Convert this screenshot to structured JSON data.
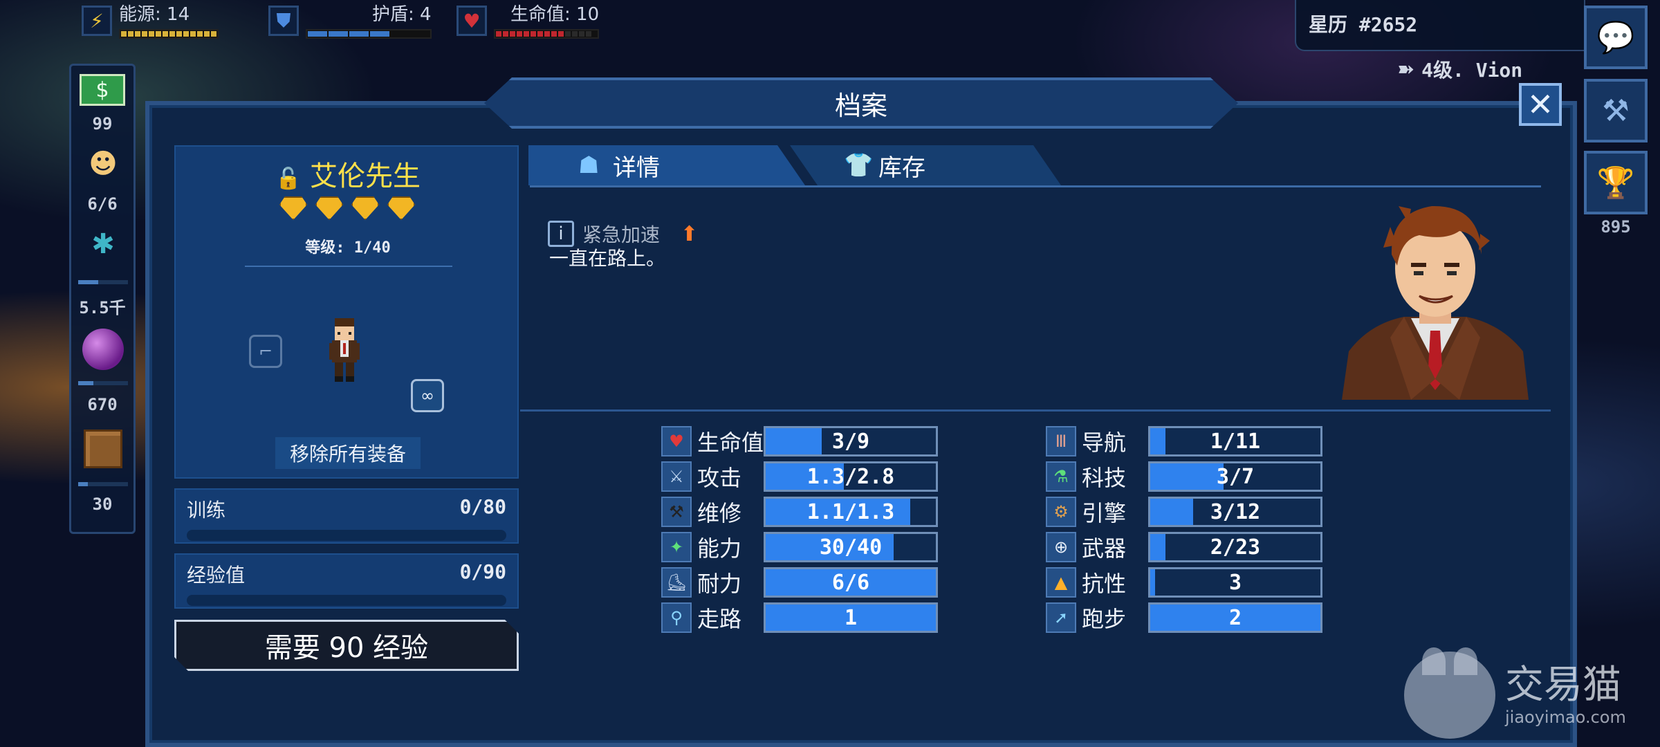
{
  "hud": {
    "energy": {
      "label": "能源: 14",
      "color": "#d8b23a"
    },
    "shield": {
      "label": "护盾: 4",
      "color": "#3a78c8"
    },
    "health": {
      "label": "生命值: 10",
      "color": "#c0262e"
    }
  },
  "calendar": "星历 #2652",
  "rank": "4级. Vion",
  "side_buttons": {
    "trophy_count": "895"
  },
  "resources": [
    {
      "icon": "money-icon",
      "value": "99"
    },
    {
      "icon": "crew-icon",
      "value": "6/6"
    },
    {
      "icon": "crystal-icon",
      "value": "5.5千"
    },
    {
      "icon": "orb-icon",
      "value": "670"
    },
    {
      "icon": "crate-icon",
      "value": "30"
    }
  ],
  "panel": {
    "title": "档案"
  },
  "character": {
    "name": "艾伦先生",
    "level": "等级: 1/40",
    "remove_label": "移除所有装备",
    "rarity_stars": 4
  },
  "training": {
    "label": "训练",
    "value": "0/80"
  },
  "experience": {
    "label": "经验值",
    "value": "0/90"
  },
  "need_button": "需要 90 经验",
  "tabs": {
    "details": "详情",
    "inventory": "库存"
  },
  "skill": {
    "name": "紧急加速",
    "description": "一直在路上。"
  },
  "stats_left": [
    {
      "icon": "heart-icon",
      "label": "生命值",
      "value": "3/9",
      "fill": 0.33
    },
    {
      "icon": "sword-icon",
      "label": "攻击",
      "value": "1.3/2.8",
      "fill": 0.46
    },
    {
      "icon": "hammer-icon",
      "label": "维修",
      "value": "1.1/1.3",
      "fill": 0.85
    },
    {
      "icon": "ability-icon",
      "label": "能力",
      "value": "30/40",
      "fill": 0.75
    },
    {
      "icon": "boot-icon",
      "label": "耐力",
      "value": "6/6",
      "fill": 1.0
    },
    {
      "icon": "walk-icon",
      "label": "走路",
      "value": "1",
      "fill": 1.0
    }
  ],
  "stats_right": [
    {
      "icon": "pilot-icon",
      "label": "导航",
      "value": "1/11",
      "fill": 0.09
    },
    {
      "icon": "flask-icon",
      "label": "科技",
      "value": "3/7",
      "fill": 0.43
    },
    {
      "icon": "engine-icon",
      "label": "引擎",
      "value": "3/12",
      "fill": 0.25
    },
    {
      "icon": "crosshair-icon",
      "label": "武器",
      "value": "2/23",
      "fill": 0.09
    },
    {
      "icon": "fire-icon",
      "label": "抗性",
      "value": "3",
      "fill": 0.03
    },
    {
      "icon": "run-icon",
      "label": "跑步",
      "value": "2",
      "fill": 1.0
    }
  ],
  "watermark": {
    "name": "交易猫",
    "site": "jiaoyimao.com"
  }
}
